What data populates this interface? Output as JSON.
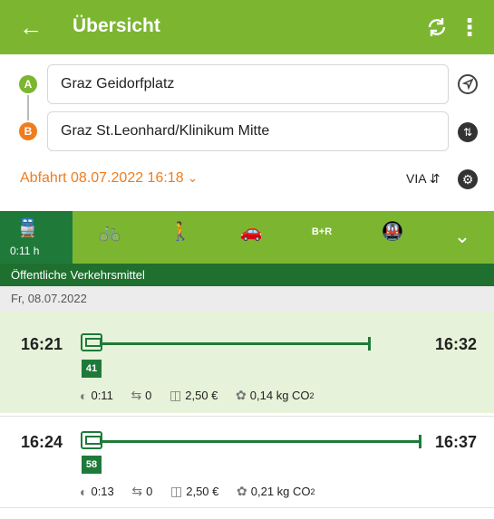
{
  "appbar": {
    "title": "Übersicht",
    "back_icon": "arrow-left-icon",
    "refresh_icon": "refresh-icon",
    "more_icon": "more-vert-icon"
  },
  "route": {
    "from_marker": "A",
    "to_marker": "B",
    "from": "Graz Geidorfplatz",
    "to": "Graz St.Leonhard/Klinikum Mitte",
    "departure": "Abfahrt 08.07.2022 16:18",
    "via": "VIA"
  },
  "modes": {
    "active_duration": "0:11 h",
    "items": [
      "public-transport-icon",
      "bicycle-icon",
      "walking-icon",
      "car-icon",
      "B+R",
      "bike-and-ride-icon"
    ]
  },
  "section_title": "Öffentliche Verkehrsmittel",
  "date": "Fr, 08.07.2022",
  "trips": [
    {
      "dep": "16:21",
      "arr": "16:32",
      "line": "41",
      "duration": "0:11",
      "changes": "0",
      "price": "2,50 €",
      "co2": "0,14 kg CO",
      "progress": 1.0
    },
    {
      "dep": "16:24",
      "arr": "16:37",
      "line": "58",
      "duration": "0:13",
      "changes": "0",
      "price": "2,50 €",
      "co2": "0,21 kg CO",
      "progress": 1.0
    }
  ],
  "colors": {
    "green": "#7cb631",
    "dark_green": "#1f7a3a",
    "orange": "#ef7d1e"
  }
}
